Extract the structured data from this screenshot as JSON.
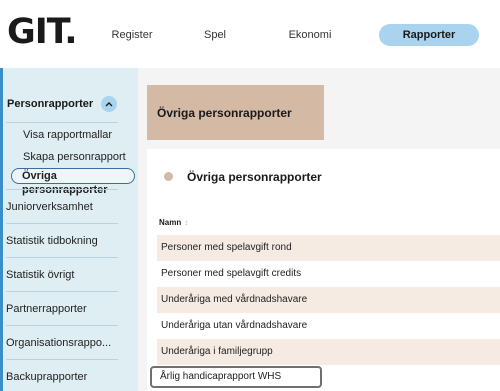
{
  "header": {
    "logo": "GIT.",
    "nav": [
      {
        "label": "Register"
      },
      {
        "label": "Spel"
      },
      {
        "label": "Ekonomi"
      },
      {
        "label": "Rapporter",
        "active": true
      }
    ]
  },
  "sidebar": {
    "section": {
      "label": "Personrapporter",
      "expanded": true,
      "icon": "chevron-up-icon",
      "items": [
        {
          "label": "Visa rapportmallar"
        },
        {
          "label": "Skapa personrapport"
        },
        {
          "label": "Övriga personrapporter",
          "selected": true
        }
      ]
    },
    "items": [
      {
        "label": "Juniorverksamhet"
      },
      {
        "label": "Statistik tidbokning"
      },
      {
        "label": "Statistik övrigt"
      },
      {
        "label": "Partnerrapporter"
      },
      {
        "label": "Organisationsrappo..."
      },
      {
        "label": "Backuprapporter"
      }
    ]
  },
  "main": {
    "banner_title": "Övriga personrapporter",
    "card": {
      "title": "Övriga personrapporter",
      "column_header": "Namn",
      "rows": [
        {
          "label": "Personer med spelavgift rond"
        },
        {
          "label": "Personer med spelavgift credits"
        },
        {
          "label": "Underåriga med vårdnadshavare"
        },
        {
          "label": "Underåriga utan vårdnadshavare"
        },
        {
          "label": "Underåriga i familjegrupp"
        },
        {
          "label": "Årlig handicaprapport WHS"
        }
      ]
    }
  },
  "colors": {
    "nav_active": "#a9d3ee",
    "sidebar_bg": "#dfeef3",
    "banner": "#d4b9a4",
    "row_tint": "#f5ebe3"
  }
}
